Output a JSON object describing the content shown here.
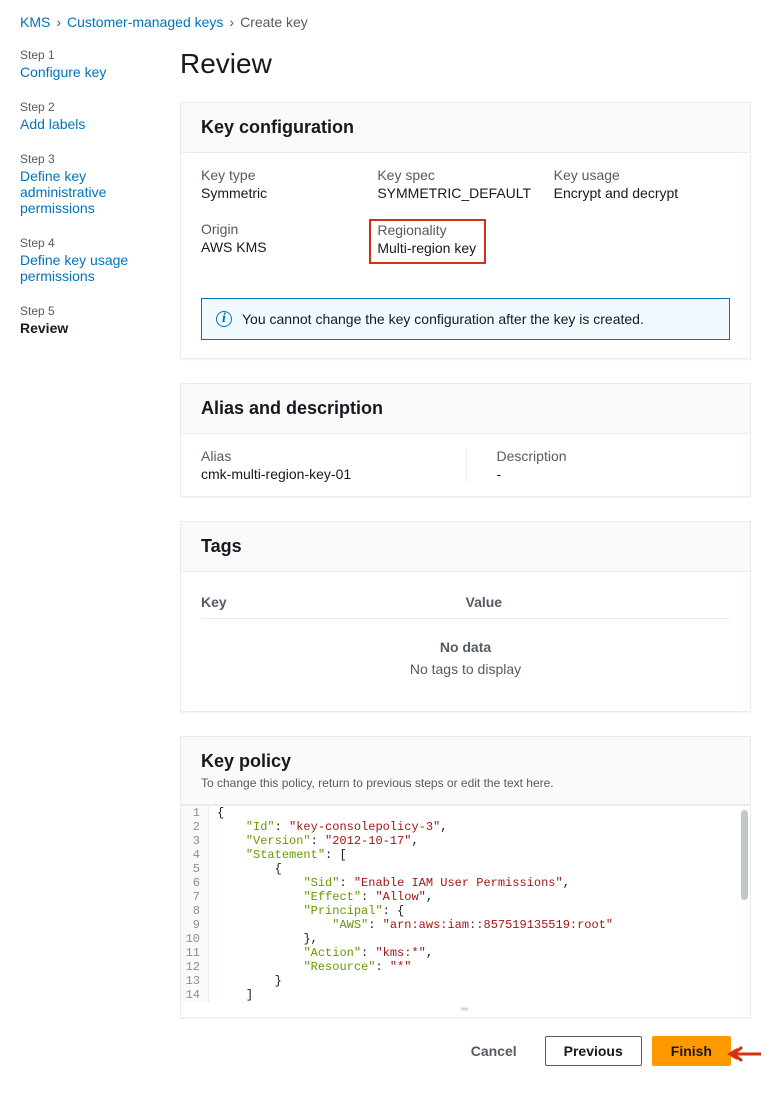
{
  "breadcrumbs": {
    "root": "KMS",
    "mid": "Customer-managed keys",
    "leaf": "Create key"
  },
  "wizard": {
    "steps": [
      {
        "num": "Step 1",
        "label": "Configure key"
      },
      {
        "num": "Step 2",
        "label": "Add labels"
      },
      {
        "num": "Step 3",
        "label": "Define key administrative permissions"
      },
      {
        "num": "Step 4",
        "label": "Define key usage permissions"
      },
      {
        "num": "Step 5",
        "label": "Review"
      }
    ]
  },
  "title": "Review",
  "key_config": {
    "header": "Key configuration",
    "key_type_label": "Key type",
    "key_type_value": "Symmetric",
    "key_spec_label": "Key spec",
    "key_spec_value": "SYMMETRIC_DEFAULT",
    "key_usage_label": "Key usage",
    "key_usage_value": "Encrypt and decrypt",
    "origin_label": "Origin",
    "origin_value": "AWS KMS",
    "regionality_label": "Regionality",
    "regionality_value": "Multi-region key",
    "info": "You cannot change the key configuration after the key is created."
  },
  "alias": {
    "header": "Alias and description",
    "alias_label": "Alias",
    "alias_value": "cmk-multi-region-key-01",
    "desc_label": "Description",
    "desc_value": "-"
  },
  "tags": {
    "header": "Tags",
    "col_key": "Key",
    "col_value": "Value",
    "nodata": "No data",
    "nomsg": "No tags to display"
  },
  "policy": {
    "header": "Key policy",
    "subtext": "To change this policy, return to previous steps or edit the text here.",
    "lines": [
      "{",
      "    \"Id\": \"key-consolepolicy-3\",",
      "    \"Version\": \"2012-10-17\",",
      "    \"Statement\": [",
      "        {",
      "            \"Sid\": \"Enable IAM User Permissions\",",
      "            \"Effect\": \"Allow\",",
      "            \"Principal\": {",
      "                \"AWS\": \"arn:aws:iam::857519135519:root\"",
      "            },",
      "            \"Action\": \"kms:*\",",
      "            \"Resource\": \"*\"",
      "        }",
      "    ]"
    ]
  },
  "buttons": {
    "cancel": "Cancel",
    "previous": "Previous",
    "finish": "Finish"
  }
}
